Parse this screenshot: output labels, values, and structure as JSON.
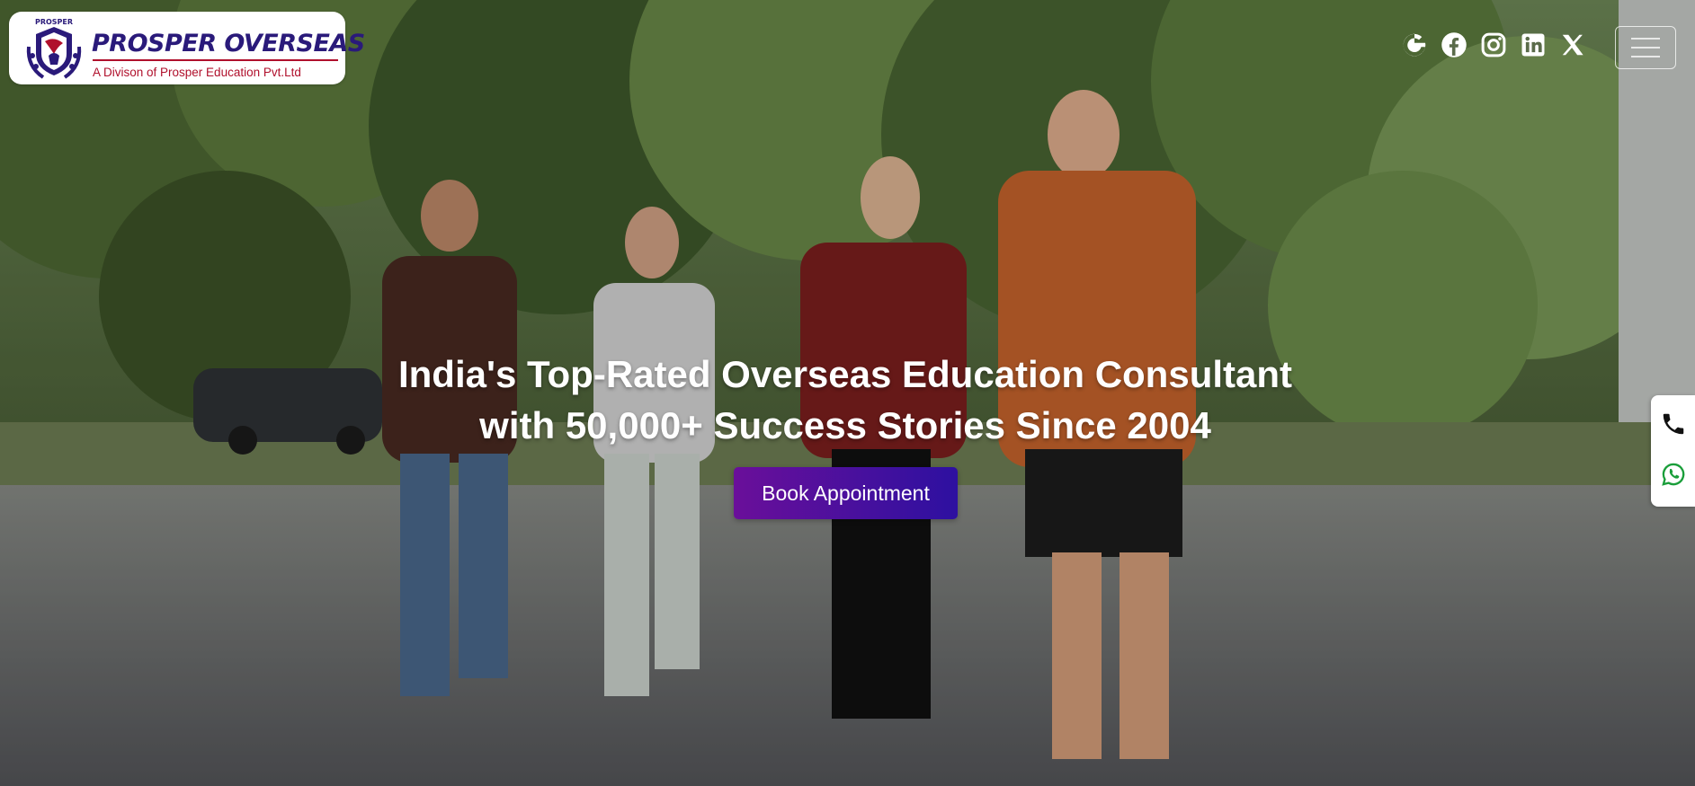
{
  "brand": {
    "name": "PROSPER OVERSEAS",
    "tagline": "A Divison of Prosper Education Pvt.Ltd",
    "emblem_text": "PROSPER",
    "colors": {
      "navy": "#2a1a7a",
      "crimson": "#b0102c"
    }
  },
  "header": {
    "social_icons": [
      {
        "name": "google-icon",
        "glyph": "G"
      },
      {
        "name": "facebook-icon",
        "glyph": "f"
      },
      {
        "name": "instagram-icon",
        "glyph": "ig"
      },
      {
        "name": "linkedin-icon",
        "glyph": "in"
      },
      {
        "name": "x-icon",
        "glyph": "X"
      }
    ],
    "menu_icon": "hamburger-menu-icon"
  },
  "hero": {
    "headline_line1": "India's Top-Rated Overseas Education Consultant",
    "headline_line2": "with 50,000+ Success Stories Since 2004",
    "cta_label": "Book Appointment",
    "cta_colors": {
      "start": "#6a0f9a",
      "end": "#2d10a0"
    }
  },
  "contact_dock": {
    "icons": [
      "phone-icon",
      "whatsapp-icon"
    ],
    "whatsapp_color": "#1a9e3a"
  }
}
